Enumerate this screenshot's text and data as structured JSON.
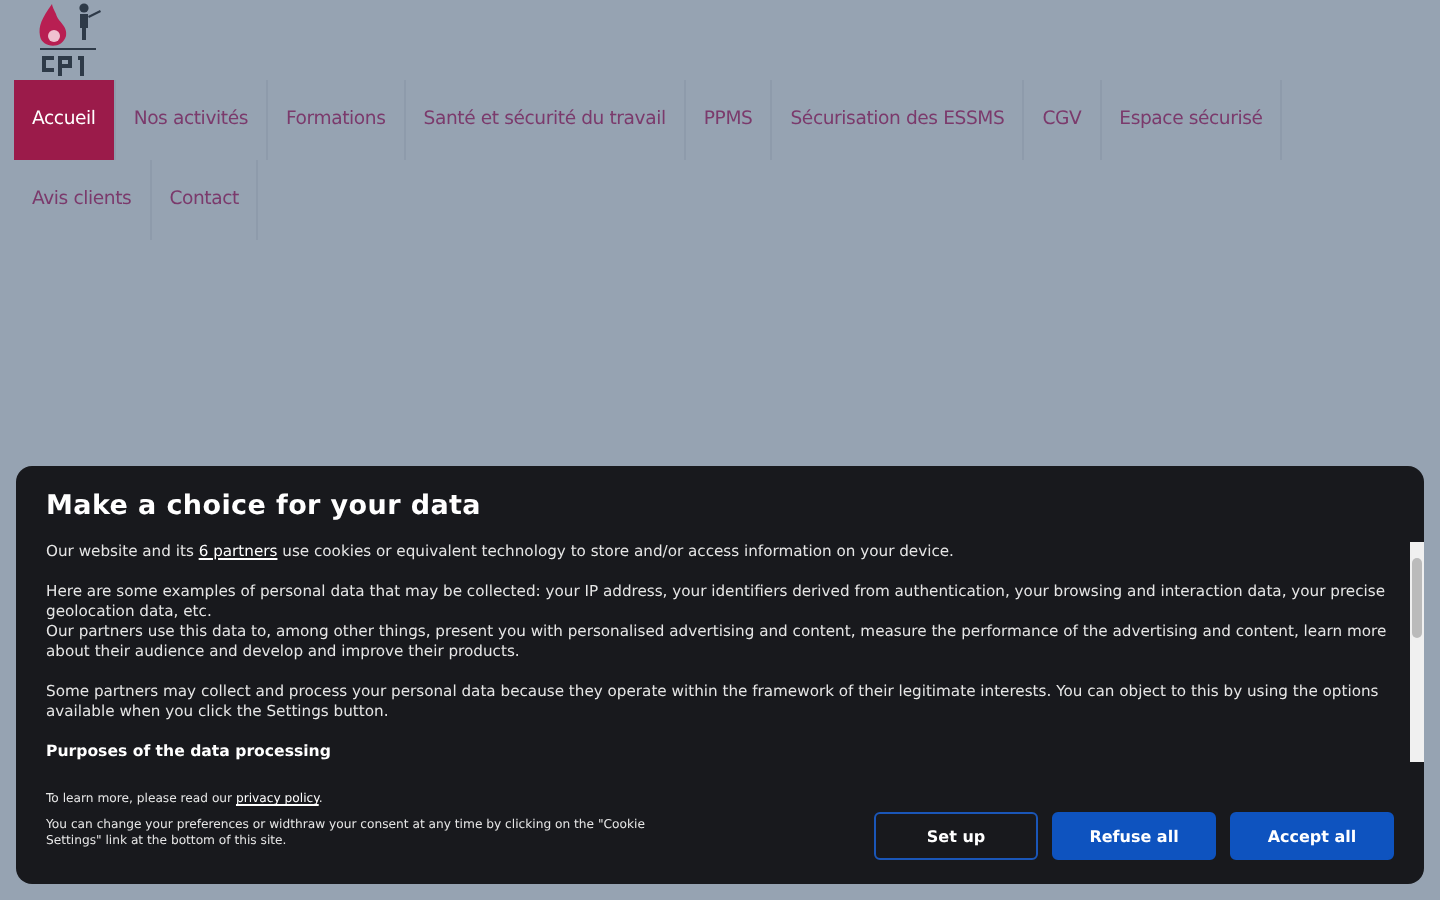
{
  "nav": {
    "items": [
      {
        "label": "Accueil",
        "selected": true
      },
      {
        "label": "Nos activités",
        "selected": false
      },
      {
        "label": "Formations",
        "selected": false
      },
      {
        "label": "Santé et sécurité du travail",
        "selected": false
      },
      {
        "label": "PPMS",
        "selected": false
      },
      {
        "label": "Sécurisation des ESSMS",
        "selected": false
      },
      {
        "label": "CGV",
        "selected": false
      },
      {
        "label": "Espace sécurisé",
        "selected": false
      },
      {
        "label": "Avis clients",
        "selected": false
      },
      {
        "label": "Contact",
        "selected": false
      }
    ]
  },
  "consent": {
    "title": "Make a choice for your data",
    "paragraphs": [
      [
        {
          "kind": "text",
          "text": "Our website and its "
        },
        {
          "kind": "link",
          "text": "6 partners"
        },
        {
          "kind": "text",
          "text": " use cookies or equivalent technology to store and/or access information on your device."
        }
      ],
      [
        {
          "kind": "text",
          "text": "Here are some examples of personal data that may be collected: your IP address, your identifiers derived from authentication, your browsing and interaction data, your precise geolocation data, etc.\nOur partners use this data to, among other things, present you with personalised advertising and content, measure the performance of the advertising and content, learn more about their audience and develop and improve their products."
        }
      ],
      [
        {
          "kind": "text",
          "text": "Some partners may collect and process your personal data because they operate within the framework of their legitimate interests. You can object to this by using the options available when you click the Settings button."
        }
      ]
    ],
    "purposes_heading": "Purposes of the data processing",
    "learn_more": [
      {
        "kind": "text",
        "text": "To learn more, please read our "
      },
      {
        "kind": "link",
        "text": "privacy policy"
      },
      {
        "kind": "text",
        "text": "."
      }
    ],
    "change_note": "You can change your preferences or widthraw your consent at any time by clicking on the \"Cookie Settings\" link at the bottom of this site.",
    "buttons": [
      {
        "label": "Set up",
        "kind": "outline"
      },
      {
        "label": "Refuse all",
        "kind": "filled"
      },
      {
        "label": "Accept all",
        "kind": "filled"
      }
    ]
  }
}
